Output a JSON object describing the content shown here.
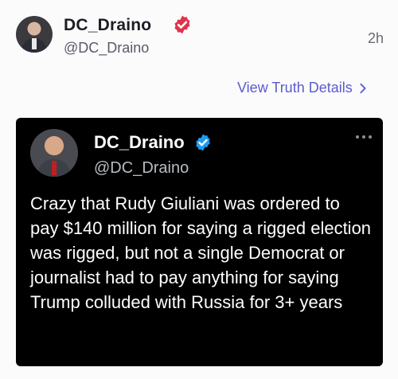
{
  "post": {
    "author_name": "DC_Draino",
    "author_handle": "@DC_Draino",
    "time": "2h",
    "view_details_label": "View Truth Details"
  },
  "embed": {
    "author_name": "DC_Draino",
    "author_handle": "@DC_Draino",
    "text": "Crazy that Rudy Giuliani was ordered to pay $140 million for saying a rigged election was rigged, but not a single Democrat or journalist had to pay anything for saying Trump colluded with Russia for 3+ years"
  },
  "colors": {
    "link": "#5b5bd0",
    "verified_red": "#e0344c",
    "verified_blue": "#1d9bf0",
    "embed_bg": "#000000"
  },
  "icons": [
    "verified-badge-red-icon",
    "verified-badge-blue-icon",
    "chevron-right-icon",
    "more-options-icon"
  ]
}
